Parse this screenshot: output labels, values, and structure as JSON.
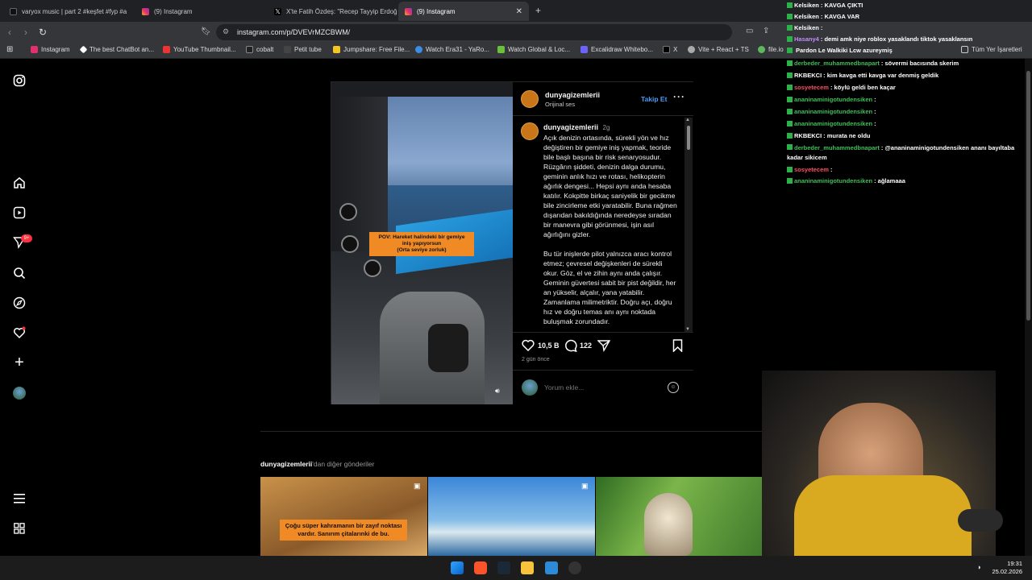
{
  "tabs": [
    {
      "title": "varyox music | part 2 #keşfet #fyp #a",
      "icon": "tiktok-icon"
    },
    {
      "title": "(9) Instagram",
      "icon": "instagram-icon"
    },
    {
      "title": "X'te Fatih Özdeş: \"Recep Tayyip Erdoğ",
      "icon": "x-icon"
    },
    {
      "title": "(9) Instagram",
      "icon": "instagram-icon"
    }
  ],
  "address": {
    "url": "instagram.com/p/DVEVrMZCBWM/"
  },
  "bookmarks": [
    "Instagram",
    "The best ChatBot an...",
    "YouTube Thumbnail...",
    "cobalt",
    "Petit tube",
    "Jumpshare: Free File...",
    "Watch Era31 - YaRo...",
    "Watch Global & Loc...",
    "Excalidraw Whitebo...",
    "X",
    "Vite + React + TS",
    "file.io",
    "Tüm Yer İşaretleri"
  ],
  "sidebar": {
    "notif_badge": "9+"
  },
  "post": {
    "username": "dunyagizemlerii",
    "audio": "Orijinal ses",
    "follow": "Takip Et",
    "time_ago": "2g",
    "overlay_line1": "POV: Hareket halindeki bir gemiye",
    "overlay_line2": "iniş yapıyorsun",
    "overlay_line3": "(Orta seviye zorluk)",
    "caption_p1": "Açık denizin ortasında, sürekli yön ve hız değiştiren bir gemiye iniş yapmak, teoride bile başlı başına bir risk senaryosudur. Rüzgârın şiddeti, denizin dalga durumu, geminin anlık hızı ve rotası, helikopterin ağırlık dengesi... Hepsi aynı anda hesaba katılır. Kokpitte birkaç saniyelik bir gecikme bile zincirleme etki yaratabilir. Buna rağmen dışarıdan bakıldığında neredeyse sıradan bir manevra gibi görünmesi, işin asıl ağırlığını gizler.",
    "caption_p2": "Bu tür inişlerde pilot yalnızca aracı kontrol etmez; çevresel değişkenleri de sürekli okur. Göz, el ve zihin aynı anda çalışır. Geminin güvertesi sabit bir pist değildir, her an yükselir, alçalır, yana yatabilir. Zamanlama milimetriktir. Doğru açı, doğru hız ve doğru temas anı aynı noktada buluşmak zorundadır.",
    "likes": "10,5 B",
    "comments": "122",
    "date": "2 gün önce",
    "comment_placeholder": "Yorum ekle..."
  },
  "more_posts": {
    "title_user": "dunyagizemlerii",
    "title_suffix": "'dan diğer gönderiler",
    "thumb1_text": "Çoğu süper kahramanın bir zayıf noktası vardır. Sanırım çitalarınki de bu."
  },
  "chat": [
    {
      "user": "Kelsiken",
      "msg": ": KAVGA ÇIKTI",
      "color": "#ffffff"
    },
    {
      "user": "Kelsiken",
      "msg": ": KAVGA VAR",
      "color": "#ffffff"
    },
    {
      "user": "Kelsiken",
      "msg": ":",
      "color": "#ffffff"
    },
    {
      "user": "Hasany4",
      "msg": ": demi amk niye roblox yasaklandı tiktok yasaklansın",
      "color": "#c48bff"
    },
    {
      "user": "",
      "msg": "Pardon Le Walkiki Lcw azureymiş",
      "color": "#ffffff"
    },
    {
      "user": "derbeder_muhammedbnapart",
      "msg": ": sövermi bacısında skerim",
      "color": "#3fbf5a"
    },
    {
      "user": "RKBEKCI",
      "msg": ": kim kavga etti kavga var denmiş geldik",
      "color": "#ffffff"
    },
    {
      "user": "sosyetecem",
      "msg": ": köylü geldi ben kaçar",
      "color": "#ff4f5e"
    },
    {
      "user": "ananinaminigotundensiken",
      "msg": ":",
      "color": "#3fbf5a"
    },
    {
      "user": "ananinaminigotundensiken",
      "msg": ":",
      "color": "#3fbf5a"
    },
    {
      "user": "ananinaminigotundensiken",
      "msg": ":",
      "color": "#3fbf5a"
    },
    {
      "user": "RKBEKCI",
      "msg": ": murata ne oldu",
      "color": "#ffffff"
    },
    {
      "user": "derbeder_muhammedbnapart",
      "msg": ": @ananinaminigotundensiken ananı bayıltaba kadar sikicem",
      "color": "#3fbf5a"
    },
    {
      "user": "sosyetecem",
      "msg": ":",
      "color": "#ff4f5e"
    },
    {
      "user": "ananinaminigotundensiken",
      "msg": ": ağlamaaa",
      "color": "#3fbf5a"
    }
  ],
  "clock": {
    "time": "19:31",
    "date": "25.02.2026"
  },
  "colors": {
    "follow": "#4a9cf6",
    "overlay": "#f08a24",
    "bg": "#000000"
  }
}
